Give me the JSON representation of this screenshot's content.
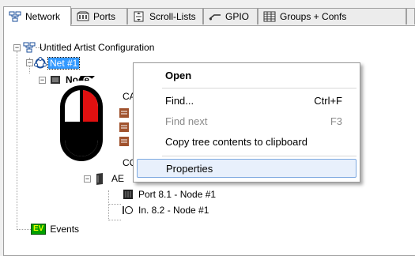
{
  "tabs": [
    {
      "label": "Network",
      "icon": "network-icon",
      "active": true
    },
    {
      "label": "Ports",
      "icon": "ports-icon",
      "active": false
    },
    {
      "label": "Scroll-Lists",
      "icon": "scroll-lists-icon",
      "active": false
    },
    {
      "label": "GPIO",
      "icon": "gpio-icon",
      "active": false
    },
    {
      "label": "Groups + Confs",
      "icon": "groups-icon",
      "active": false
    }
  ],
  "tree": {
    "root": "Untitled Artist Configuration",
    "net": "Net #1",
    "node_partial": "Node",
    "children": [
      "CA",
      "CO",
      "AE"
    ],
    "port_in": "Port 8.1 - Node #1",
    "port_out": "In. 8.2 - Node #1",
    "events": "Events",
    "events_badge": "EV"
  },
  "menu": {
    "open": "Open",
    "find": "Find...",
    "find_shortcut": "Ctrl+F",
    "find_next": "Find next",
    "find_next_shortcut": "F3",
    "copy": "Copy tree contents to clipboard",
    "properties": "Properties"
  },
  "colors": {
    "selection": "#3399ff",
    "menu_hover": "#e8f0fc",
    "mouse_button": "#e01010",
    "events_badge_bg": "#00a000",
    "events_badge_fg": "#e8ff00"
  }
}
